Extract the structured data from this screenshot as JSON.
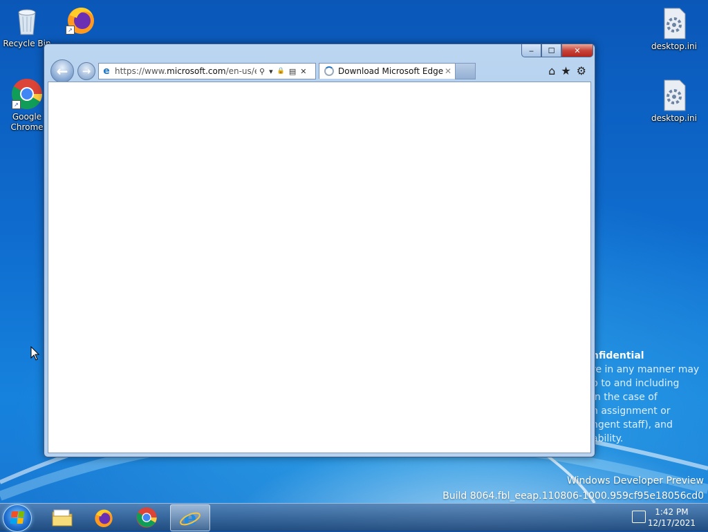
{
  "desktop": {
    "icons": [
      {
        "label": "Recycle Bin",
        "icon": "recycle-bin-icon"
      },
      {
        "label": "Firefox",
        "icon": "firefox-icon"
      },
      {
        "label": "Google Chrome",
        "icon": "chrome-icon"
      },
      {
        "label": "desktop.ini",
        "icon": "settings-file-icon"
      },
      {
        "label": "desktop.ini",
        "icon": "settings-file-icon"
      }
    ],
    "watermark_lines": [
      "nfidential",
      "re in any manner may",
      "p to and including",
      "in the case of",
      "n assignment or",
      "ngent staff), and",
      "ability."
    ],
    "build_title": "Windows Developer Preview",
    "build_string": "Build 8064.fbl_eeap.110806-1000.959cf95e18056cd0"
  },
  "browser": {
    "url_prefix": "https://www.",
    "url_domain": "microsoft.com",
    "url_rest": "/en-us/edge",
    "tab_title": "Download Microsoft Edge ...",
    "caption": {
      "minimize": "‒",
      "maximize": "☐",
      "close": "✕"
    },
    "nav": {
      "back": "←",
      "forward": "→"
    },
    "addr_tools": {
      "search": "⚲",
      "dropdown": "▾",
      "lock": "🔒",
      "compat": "▤",
      "stop": "✕"
    },
    "right_tools": {
      "home": "⌂",
      "favorites": "★",
      "settings": "⚙"
    }
  },
  "taskbar": {
    "pinned": [
      "explorer-icon",
      "firefox-icon",
      "chrome-icon",
      "internet-explorer-icon"
    ],
    "time": "1:42 PM",
    "date": "12/17/2021"
  },
  "colors": {
    "accent": "#1f76c7",
    "close": "#c8453b"
  }
}
